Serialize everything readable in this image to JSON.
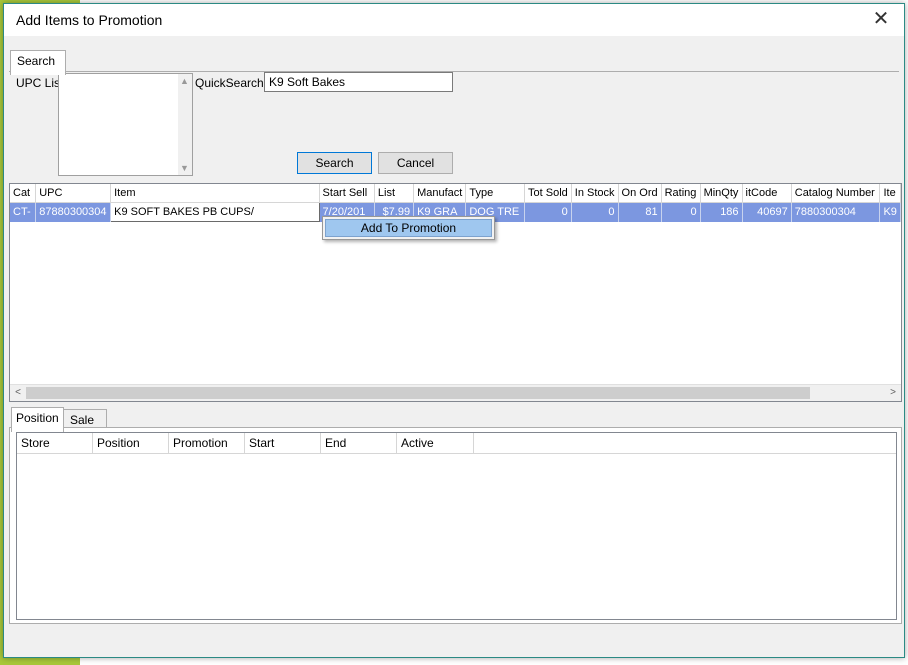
{
  "dialog": {
    "title": "Add Items to Promotion",
    "close_glyph": "✕"
  },
  "search_tab": {
    "label": "Search"
  },
  "search": {
    "upc_list_label": "UPC List",
    "quicksearch_label": "QuickSearch",
    "quicksearch_value": "K9 Soft Bakes",
    "search_button": "Search",
    "cancel_button": "Cancel"
  },
  "results": {
    "columns": [
      "Cat",
      "UPC",
      "Item",
      "Start Sell",
      "List",
      "Manufact",
      "Type",
      "Tot Sold",
      "In Stock",
      "On Ord",
      "Rating",
      "MinQty",
      "itCode",
      "Catalog Number",
      "Ite"
    ],
    "rows": [
      {
        "cat": "CT-",
        "upc": "87880300304",
        "item": "K9 SOFT BAKES PB CUPS/",
        "start_sell": "7/20/201",
        "list": "$7.99",
        "manufact": "K9 GRA",
        "type": "DOG TRE",
        "tot_sold": "0",
        "in_stock": "0",
        "on_ord": "81",
        "rating": "0",
        "min_qty": "186",
        "itcode": "40697",
        "catalog_number": "7880300304",
        "ite": "K9"
      }
    ]
  },
  "context_menu": {
    "item": "Add To Promotion"
  },
  "bottom_tabs": {
    "position": "Position",
    "sale": "Sale"
  },
  "position_grid": {
    "columns": [
      "Store",
      "Position",
      "Promotion",
      "Start",
      "End",
      "Active"
    ]
  },
  "colors": {
    "accent_border": "#2b8a84",
    "selection": "#7c97e0",
    "menu_highlight": "#9fc7ef"
  }
}
